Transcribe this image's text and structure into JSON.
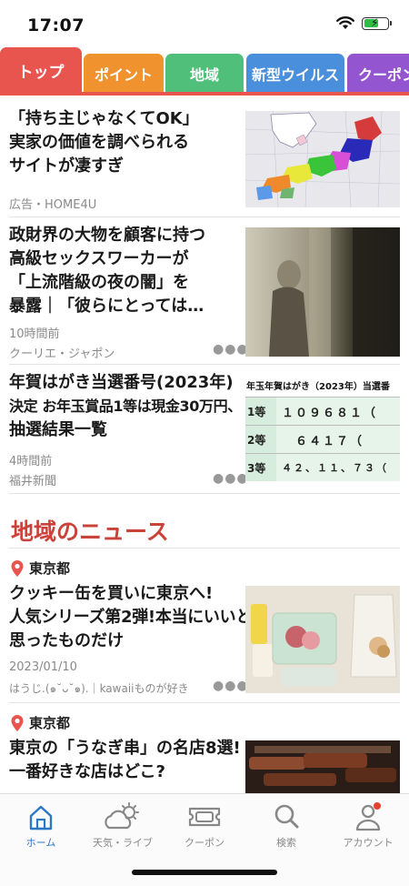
{
  "status_bar": {
    "time": "17:07"
  },
  "tabs": [
    {
      "label": "トップ",
      "color": "#e8544e"
    },
    {
      "label": "ポイント",
      "color": "#f0922e"
    },
    {
      "label": "地域",
      "color": "#4fbf7a"
    },
    {
      "label": "新型ウイルス",
      "color": "#4a8fdc"
    },
    {
      "label": "クーポン",
      "color": "#9355d0"
    }
  ],
  "articles": [
    {
      "title_lines": [
        "「持ち主じゃなくてOK」",
        "実家の価値を調べられる",
        "サイトが凄すぎ"
      ],
      "meta": [
        "広告・HOME4U"
      ]
    },
    {
      "title_lines": [
        "政財界の大物を顧客に持つ",
        "高級セックスワーカーが",
        "「上流階級の夜の闇」を",
        "暴露｜「彼らにとっては…"
      ],
      "meta": [
        "10時間前",
        "クーリエ・ジャポン"
      ]
    },
    {
      "title_lines": [
        "年賀はがき当選番号(2023年)",
        "決定 お年玉賞品1等は現金30万円、",
        "抽選結果一覧"
      ],
      "meta": [
        "4時間前",
        "福井新聞"
      ],
      "thumb_table": {
        "caption": "年玉年賀はがき（2023年）当選番",
        "rows": [
          {
            "head": "1等",
            "value": "１０９６８１（"
          },
          {
            "head": "2等",
            "value": "　６４１７（"
          },
          {
            "head": "3等",
            "value": "４２、１１、７３（"
          }
        ]
      }
    }
  ],
  "section": {
    "title": "地域のニュース"
  },
  "regional": [
    {
      "region": "東京都",
      "title_lines": [
        "クッキー缶を買いに東京へ!",
        "人気シリーズ第2弾!本当にいいと",
        "思ったものだけ"
      ],
      "meta": [
        "2023/01/10",
        "はうじ.(๑˘ᴗ˘๑).｜kawaiiものが好き"
      ]
    },
    {
      "region": "東京都",
      "title_lines": [
        "東京の「うなぎ串」の名店8選!",
        "一番好きな店はどこ?"
      ]
    }
  ],
  "bottom_nav": [
    {
      "label": "ホーム",
      "icon": "home-icon"
    },
    {
      "label": "天気・ライブ",
      "icon": "weather-icon"
    },
    {
      "label": "クーポン",
      "icon": "coupon-icon"
    },
    {
      "label": "検索",
      "icon": "search-icon"
    },
    {
      "label": "アカウント",
      "icon": "account-icon"
    }
  ],
  "colors": {
    "accent_red": "#c9433a",
    "active_blue": "#2b77c8",
    "badge_red": "#e8412f"
  }
}
